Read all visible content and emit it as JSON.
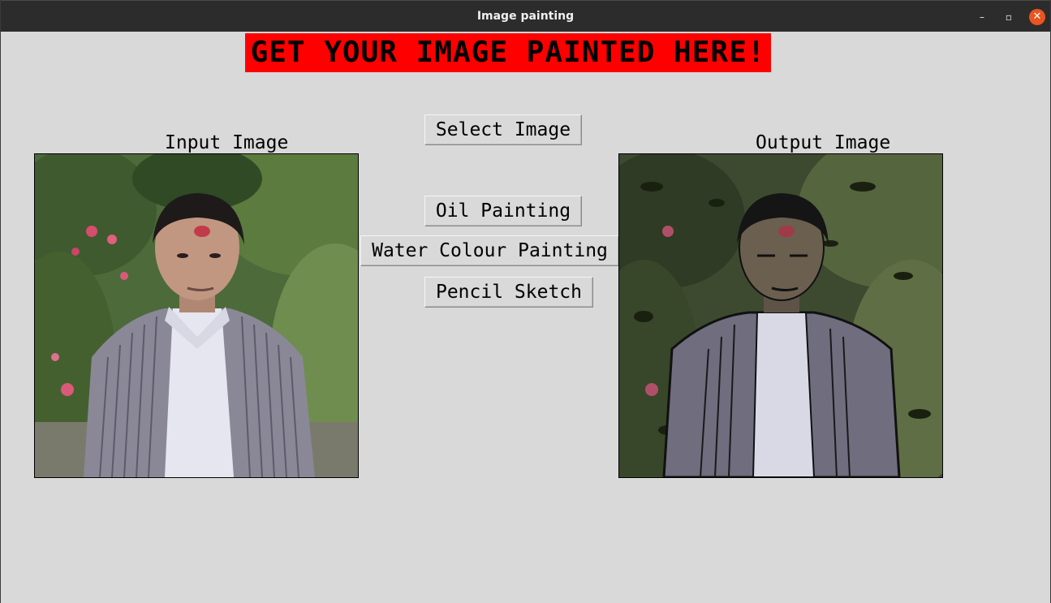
{
  "window": {
    "title": "Image painting",
    "controls": {
      "minimize": "–",
      "maximize": "▫",
      "close": "✕"
    }
  },
  "banner": {
    "text": "GET YOUR IMAGE PAINTED HERE!",
    "background": "#ff0000"
  },
  "labels": {
    "input": "Input Image",
    "output": "Output Image"
  },
  "buttons": {
    "select": "Select Image",
    "oil": "Oil Painting",
    "water": "Water Colour Painting",
    "pencil": "Pencil Sketch"
  }
}
